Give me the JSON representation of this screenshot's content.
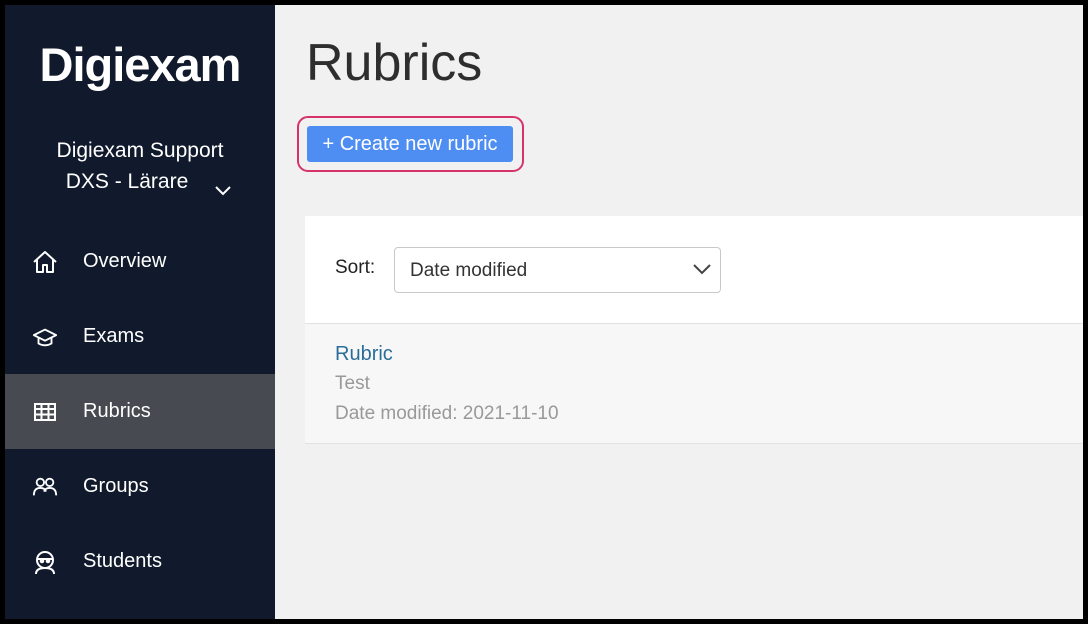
{
  "brand": {
    "logo_text": "Digiexam"
  },
  "org": {
    "name": "Digiexam Support",
    "role": "DXS - Lärare"
  },
  "nav": {
    "items": [
      {
        "label": "Overview",
        "icon": "home-icon"
      },
      {
        "label": "Exams",
        "icon": "graduation-cap-icon"
      },
      {
        "label": "Rubrics",
        "icon": "table-icon",
        "active": true
      },
      {
        "label": "Groups",
        "icon": "users-icon"
      },
      {
        "label": "Students",
        "icon": "student-icon"
      }
    ]
  },
  "page": {
    "title": "Rubrics",
    "create_button": "+ Create new rubric"
  },
  "sort": {
    "label": "Sort:",
    "value": "Date modified"
  },
  "rubrics": [
    {
      "title": "Rubric",
      "description": "Test",
      "date": "Date modified: 2021-11-10"
    }
  ],
  "colors": {
    "sidebar_bg": "#111a2c",
    "active_item": "#474a50",
    "primary_button": "#4e8ef3",
    "highlight": "#d6336c",
    "link": "#2b6d9a"
  }
}
